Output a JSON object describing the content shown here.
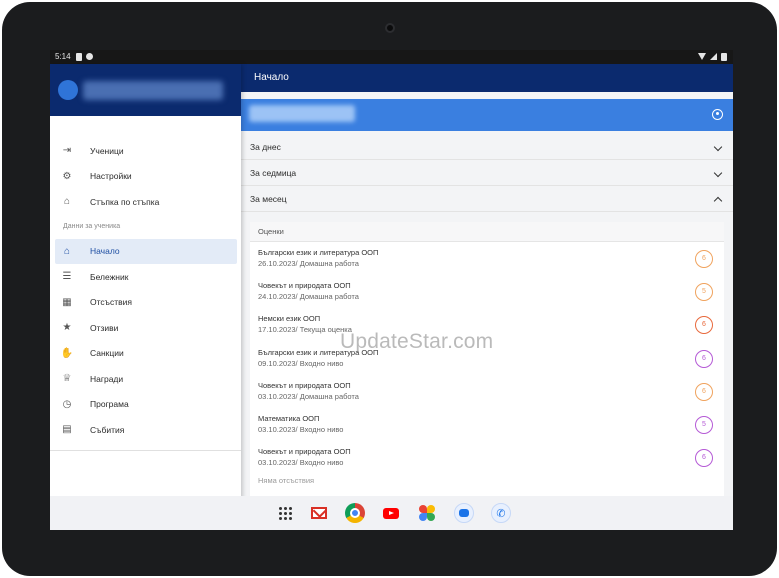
{
  "status": {
    "time": "5:14"
  },
  "app_bar": {
    "title": "Начало"
  },
  "drawer": {
    "items_top": [
      {
        "name": "sidebar-item-students",
        "icon": "login-icon",
        "glyph": "⇥",
        "label": "Ученици"
      },
      {
        "name": "sidebar-item-settings",
        "icon": "gear-icon",
        "glyph": "⚙",
        "label": "Настройки"
      },
      {
        "name": "sidebar-item-step-by-step",
        "icon": "school-icon",
        "glyph": "⌂",
        "label": "Стъпка по стъпка"
      }
    ],
    "section_title": "Данни за ученика",
    "items_student": [
      {
        "name": "sidebar-item-home",
        "icon": "home-icon",
        "glyph": "⌂",
        "label": "Начало",
        "active": true
      },
      {
        "name": "sidebar-item-notebook",
        "icon": "list-icon",
        "glyph": "☰",
        "label": "Бележник"
      },
      {
        "name": "sidebar-item-absences",
        "icon": "calendar-icon",
        "glyph": "▦",
        "label": "Отсъствия"
      },
      {
        "name": "sidebar-item-reviews",
        "icon": "star-icon",
        "glyph": "★",
        "label": "Отзиви"
      },
      {
        "name": "sidebar-item-sanctions",
        "icon": "hand-icon",
        "glyph": "✋",
        "label": "Санкции"
      },
      {
        "name": "sidebar-item-awards",
        "icon": "trophy-icon",
        "glyph": "♕",
        "label": "Награди"
      },
      {
        "name": "sidebar-item-schedule",
        "icon": "clock-icon",
        "glyph": "◷",
        "label": "Програма"
      },
      {
        "name": "sidebar-item-events",
        "icon": "event-icon",
        "glyph": "▤",
        "label": "Събития"
      }
    ]
  },
  "accordion": [
    {
      "label": "За днес",
      "expanded": false
    },
    {
      "label": "За седмица",
      "expanded": false
    },
    {
      "label": "За месец",
      "expanded": true
    }
  ],
  "grades": {
    "header": "Оценки",
    "rows": [
      {
        "subject": "Български език и литература ООП",
        "meta": "26.10.2023/ Домашна работа",
        "grade": "6",
        "color": "#f0a35e"
      },
      {
        "subject": "Човекът и природата ООП",
        "meta": "24.10.2023/ Домашна работа",
        "grade": "5",
        "color": "#f0a35e"
      },
      {
        "subject": "Немски език ООП",
        "meta": "17.10.2023/ Текуща оценка",
        "grade": "6",
        "color": "#e8693c"
      },
      {
        "subject": "Български език и литература ООП",
        "meta": "09.10.2023/ Входно ниво",
        "grade": "6",
        "color": "#b55ad6"
      },
      {
        "subject": "Човекът и природата ООП",
        "meta": "03.10.2023/ Домашна работа",
        "grade": "6",
        "color": "#f0a35e"
      },
      {
        "subject": "Математика ООП",
        "meta": "03.10.2023/ Входно ниво",
        "grade": "5",
        "color": "#b55ad6"
      },
      {
        "subject": "Човекът и природата ООП",
        "meta": "03.10.2023/ Входно ниво",
        "grade": "6",
        "color": "#b55ad6"
      }
    ],
    "no_absences": "Няма отсъствия"
  },
  "watermark": "UpdateStar.com",
  "dock": [
    {
      "name": "app-drawer-icon"
    },
    {
      "name": "gmail-icon"
    },
    {
      "name": "chrome-icon"
    },
    {
      "name": "youtube-icon"
    },
    {
      "name": "photos-icon"
    },
    {
      "name": "messages-icon"
    },
    {
      "name": "phone-icon"
    }
  ]
}
